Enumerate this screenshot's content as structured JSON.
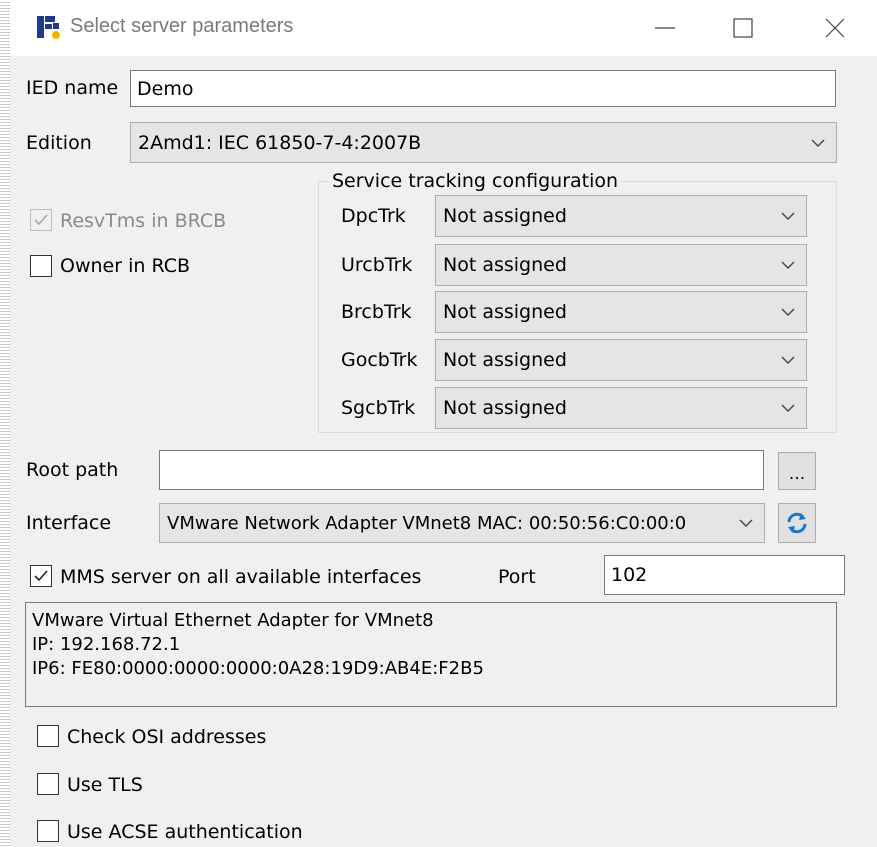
{
  "window": {
    "title": "Select server parameters"
  },
  "ied_name": {
    "label": "IED name",
    "value": "Demo"
  },
  "edition": {
    "label": "Edition",
    "value": "2Amd1: IEC 61850-7-4:2007B"
  },
  "checks": {
    "resv_tms": {
      "label": "ResvTms in BRCB",
      "checked": true,
      "enabled": false
    },
    "owner_rcb": {
      "label": "Owner in RCB",
      "checked": false
    }
  },
  "service_tracking": {
    "title": "Service tracking configuration",
    "rows": [
      {
        "label": "DpcTrk",
        "value": "Not assigned"
      },
      {
        "label": "UrcbTrk",
        "value": "Not assigned"
      },
      {
        "label": "BrcbTrk",
        "value": "Not assigned"
      },
      {
        "label": "GocbTrk",
        "value": "Not assigned"
      },
      {
        "label": "SgcbTrk",
        "value": "Not assigned"
      }
    ]
  },
  "root_path": {
    "label": "Root path",
    "value": "",
    "browse_label": "..."
  },
  "interface": {
    "label": "Interface",
    "value": "VMware Network Adapter VMnet8 MAC: 00:50:56:C0:00:0"
  },
  "mms": {
    "label": "MMS server on all available interfaces",
    "checked": true
  },
  "port": {
    "label": "Port",
    "value": "102"
  },
  "info": {
    "line1": "VMware Virtual Ethernet Adapter for VMnet8",
    "line2": "IP: 192.168.72.1",
    "line3": "IP6: FE80:0000:0000:0000:0A28:19D9:AB4E:F2B5"
  },
  "options": {
    "check_osi": {
      "label": "Check OSI addresses",
      "checked": false
    },
    "use_tls": {
      "label": "Use TLS",
      "checked": false
    },
    "use_acse": {
      "label": "Use ACSE authentication",
      "checked": false
    }
  }
}
